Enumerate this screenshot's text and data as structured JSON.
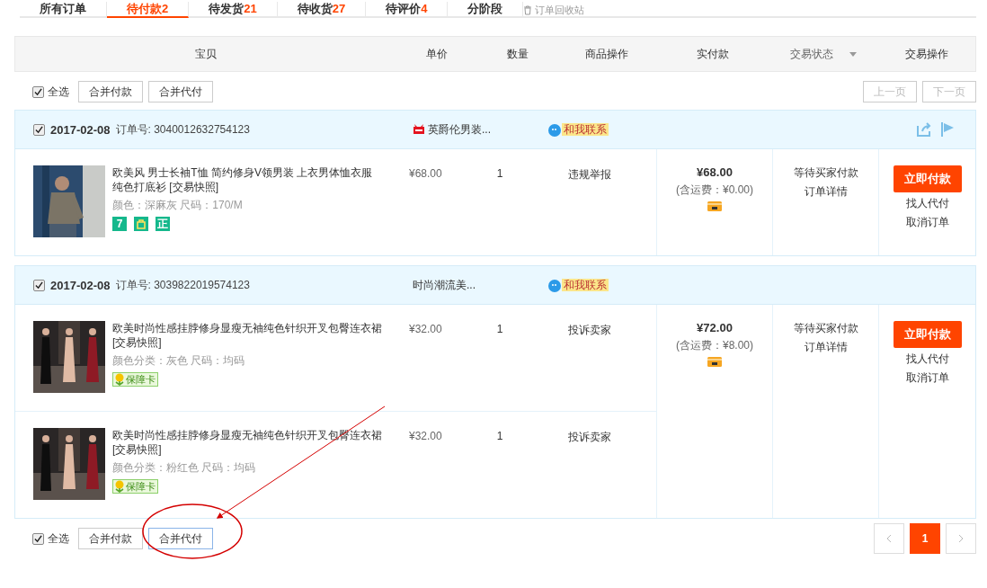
{
  "tabs": [
    {
      "label": "所有订单",
      "selected": false
    },
    {
      "label": "待付款",
      "count": "2",
      "selected": true
    },
    {
      "label": "待发货",
      "count": "21",
      "selected": false
    },
    {
      "label": "待收货",
      "count": "27",
      "selected": false
    },
    {
      "label": "待评价",
      "count": "4",
      "selected": false
    },
    {
      "label": "分阶段",
      "selected": false
    }
  ],
  "recycle_bin": "订单回收站",
  "columns": [
    {
      "label": "宝贝",
      "kind": "plain"
    },
    {
      "label": "单价",
      "kind": "plain"
    },
    {
      "label": "数量",
      "kind": "plain"
    },
    {
      "label": "商品操作",
      "kind": "plain"
    },
    {
      "label": "实付款",
      "kind": "plain"
    },
    {
      "label": "交易状态",
      "kind": "dropdown"
    },
    {
      "label": "交易操作",
      "kind": "plain"
    }
  ],
  "top_toolbar": {
    "select_all": {
      "label": "全选",
      "checked": true
    },
    "buttons": [
      "合并付款",
      "合并代付"
    ],
    "pager": [
      "上一页",
      "下一页"
    ]
  },
  "orders": [
    {
      "checked": true,
      "date": "2017-02-08",
      "order_no_label": "订单号:",
      "order_no": "3040012632754123",
      "shop": {
        "name": "英爵伦男装...",
        "tmall": true
      },
      "contact": "和我联系",
      "share_icons": true,
      "items": [
        {
          "title": "欧美风 男士长袖T恤 简约修身V领男装 上衣男体恤衣服纯色打底衫",
          "snapshot": "[交易快照]",
          "specs": "颜色：深麻灰  尺码：170/M",
          "badges": [
            {
              "kind": "seven",
              "label": "7"
            },
            {
              "kind": "bag"
            },
            {
              "kind": "genuine",
              "label": "正"
            }
          ],
          "price": "¥68.00",
          "qty": "1",
          "operation": "违规举报"
        }
      ],
      "total": "¥68.00",
      "shipping": "(含运费：¥0.00)",
      "status": "等待买家付款",
      "detail": "订单详情",
      "pay": "立即付款",
      "actions": [
        "找人代付",
        "取消订单"
      ]
    },
    {
      "checked": true,
      "date": "2017-02-08",
      "order_no_label": "订单号:",
      "order_no": "3039822019574123",
      "shop": {
        "name": "时尚潮流美...",
        "tmall": false
      },
      "contact": "和我联系",
      "share_icons": false,
      "items": [
        {
          "title": "欧美时尚性感挂脖修身显瘦无袖纯色针织开叉包臀连衣裙",
          "snapshot": "[交易快照]",
          "specs": "颜色分类：灰色  尺码：均码",
          "badges": [
            {
              "kind": "card",
              "label": "保障卡"
            }
          ],
          "price": "¥32.00",
          "qty": "1",
          "operation": "投诉卖家"
        },
        {
          "title": "欧美时尚性感挂脖修身显瘦无袖纯色针织开叉包臀连衣裙",
          "snapshot": "[交易快照]",
          "specs": "颜色分类：粉红色  尺码：均码",
          "badges": [
            {
              "kind": "card",
              "label": "保障卡"
            }
          ],
          "price": "¥32.00",
          "qty": "1",
          "operation": "投诉卖家"
        }
      ],
      "total": "¥72.00",
      "shipping": "(含运费：¥8.00)",
      "status": "等待买家付款",
      "detail": "订单详情",
      "pay": "立即付款",
      "actions": [
        "找人代付",
        "取消订单"
      ]
    }
  ],
  "bottom_toolbar": {
    "select_all": {
      "label": "全选",
      "checked": true
    },
    "buttons": [
      {
        "label": "合并付款",
        "focused": false
      },
      {
        "label": "合并代付",
        "focused": true
      }
    ],
    "pages": [
      {
        "label": "1",
        "selected": true
      }
    ]
  }
}
